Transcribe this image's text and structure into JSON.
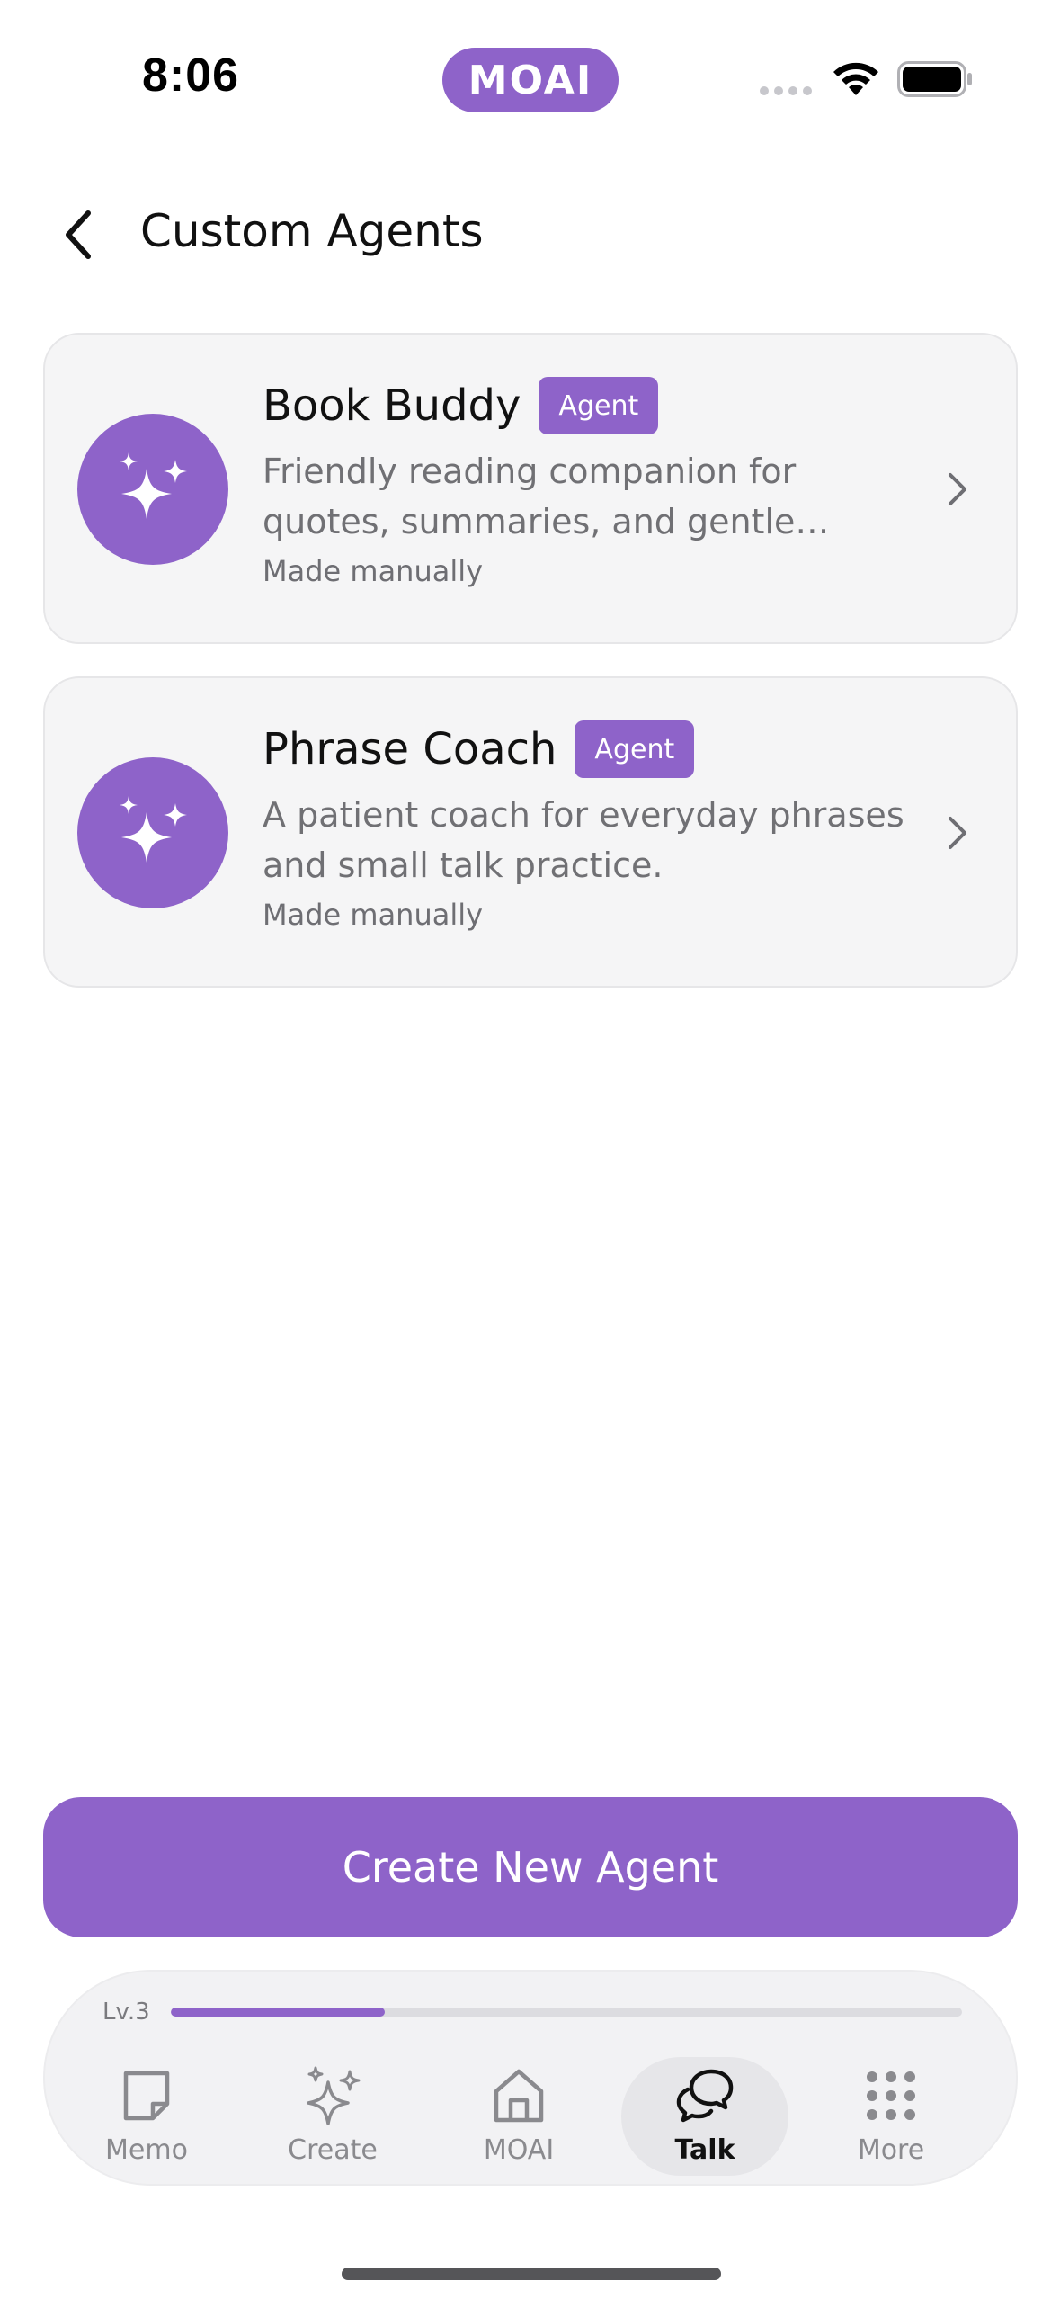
{
  "status_bar": {
    "time": "8:06",
    "app_logo_text": "MOAI",
    "icons": [
      "signal-icon",
      "wifi-icon",
      "battery-icon"
    ]
  },
  "header": {
    "title": "Custom Agents",
    "back_icon": "chevron-left-icon"
  },
  "agents": [
    {
      "name": "Book Buddy",
      "badge": "Agent",
      "description": "Friendly reading companion for quotes, summaries, and gentle recommendations.",
      "meta": "Made manually",
      "icon": "sparkles-icon"
    },
    {
      "name": "Phrase Coach",
      "badge": "Agent",
      "description": "A patient coach for everyday phrases and small talk practice.",
      "meta": "Made manually",
      "icon": "sparkles-icon"
    }
  ],
  "create_button_label": "Create New Agent",
  "tab_bar": {
    "level_label": "Lv.3",
    "level_progress": 0.27,
    "tabs": [
      {
        "label": "Memo",
        "icon": "memo-icon",
        "active": false
      },
      {
        "label": "Create",
        "icon": "sparkles-outline-icon",
        "active": false
      },
      {
        "label": "MOAI",
        "icon": "home-icon",
        "active": false
      },
      {
        "label": "Talk",
        "icon": "chat-bubbles-icon",
        "active": true
      },
      {
        "label": "More",
        "icon": "grid-dots-icon",
        "active": false
      }
    ]
  },
  "colors": {
    "accent": "#8e63c9",
    "card_background": "#f5f5f6",
    "muted_text": "#707074"
  }
}
